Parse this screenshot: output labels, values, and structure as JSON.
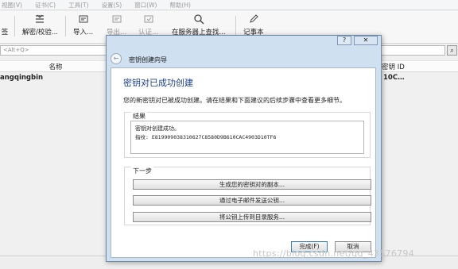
{
  "menubar": {
    "items": [
      "视图(V)",
      "证书(C)",
      "工具(T)",
      "设置(S)",
      "窗口(W)",
      "帮助(H)"
    ]
  },
  "toolbar": {
    "items": [
      {
        "label": "签",
        "icon": "sign-icon"
      },
      {
        "label": "解密/校验...",
        "icon": "decrypt-verify-icon"
      },
      {
        "label": "导入...",
        "icon": "import-icon"
      },
      {
        "label": "导出...",
        "icon": "export-icon"
      },
      {
        "label": "认证...",
        "icon": "certify-icon"
      },
      {
        "label": "在服务器上查找...",
        "icon": "search-icon"
      },
      {
        "label": "记事本",
        "icon": "notepad-icon"
      }
    ]
  },
  "search": {
    "placeholder": "<Alt+Q>"
  },
  "table": {
    "headers": {
      "name": "名称",
      "key_id": "密钥 ID"
    },
    "rows": [
      {
        "name": "angqingbin",
        "key_id": "10C…"
      }
    ]
  },
  "dialog": {
    "window_title": "密钥创建向导",
    "help_button": "?",
    "close_button": "✕",
    "heading": "密钥对已成功创建",
    "description": "您的新密钥对已被成功创建。请在结果和下面建议的后续步骤中查看更多细节。",
    "result_group_label": "结果",
    "result_line1": "密钥对创建成功。",
    "result_line2": "指纹: E819909038310627C8580D9B610CAC4903D10TF6",
    "next_steps_label": "下一步",
    "btn_backup": "生成您的密钥对的副本...",
    "btn_email": "通过电子邮件发送公钥...",
    "btn_upload": "将公钥上传到目录服务...",
    "btn_finish": "完成(F)",
    "btn_cancel": "取消"
  },
  "watermark": "https://blog.csdn.net/qq_43576794"
}
